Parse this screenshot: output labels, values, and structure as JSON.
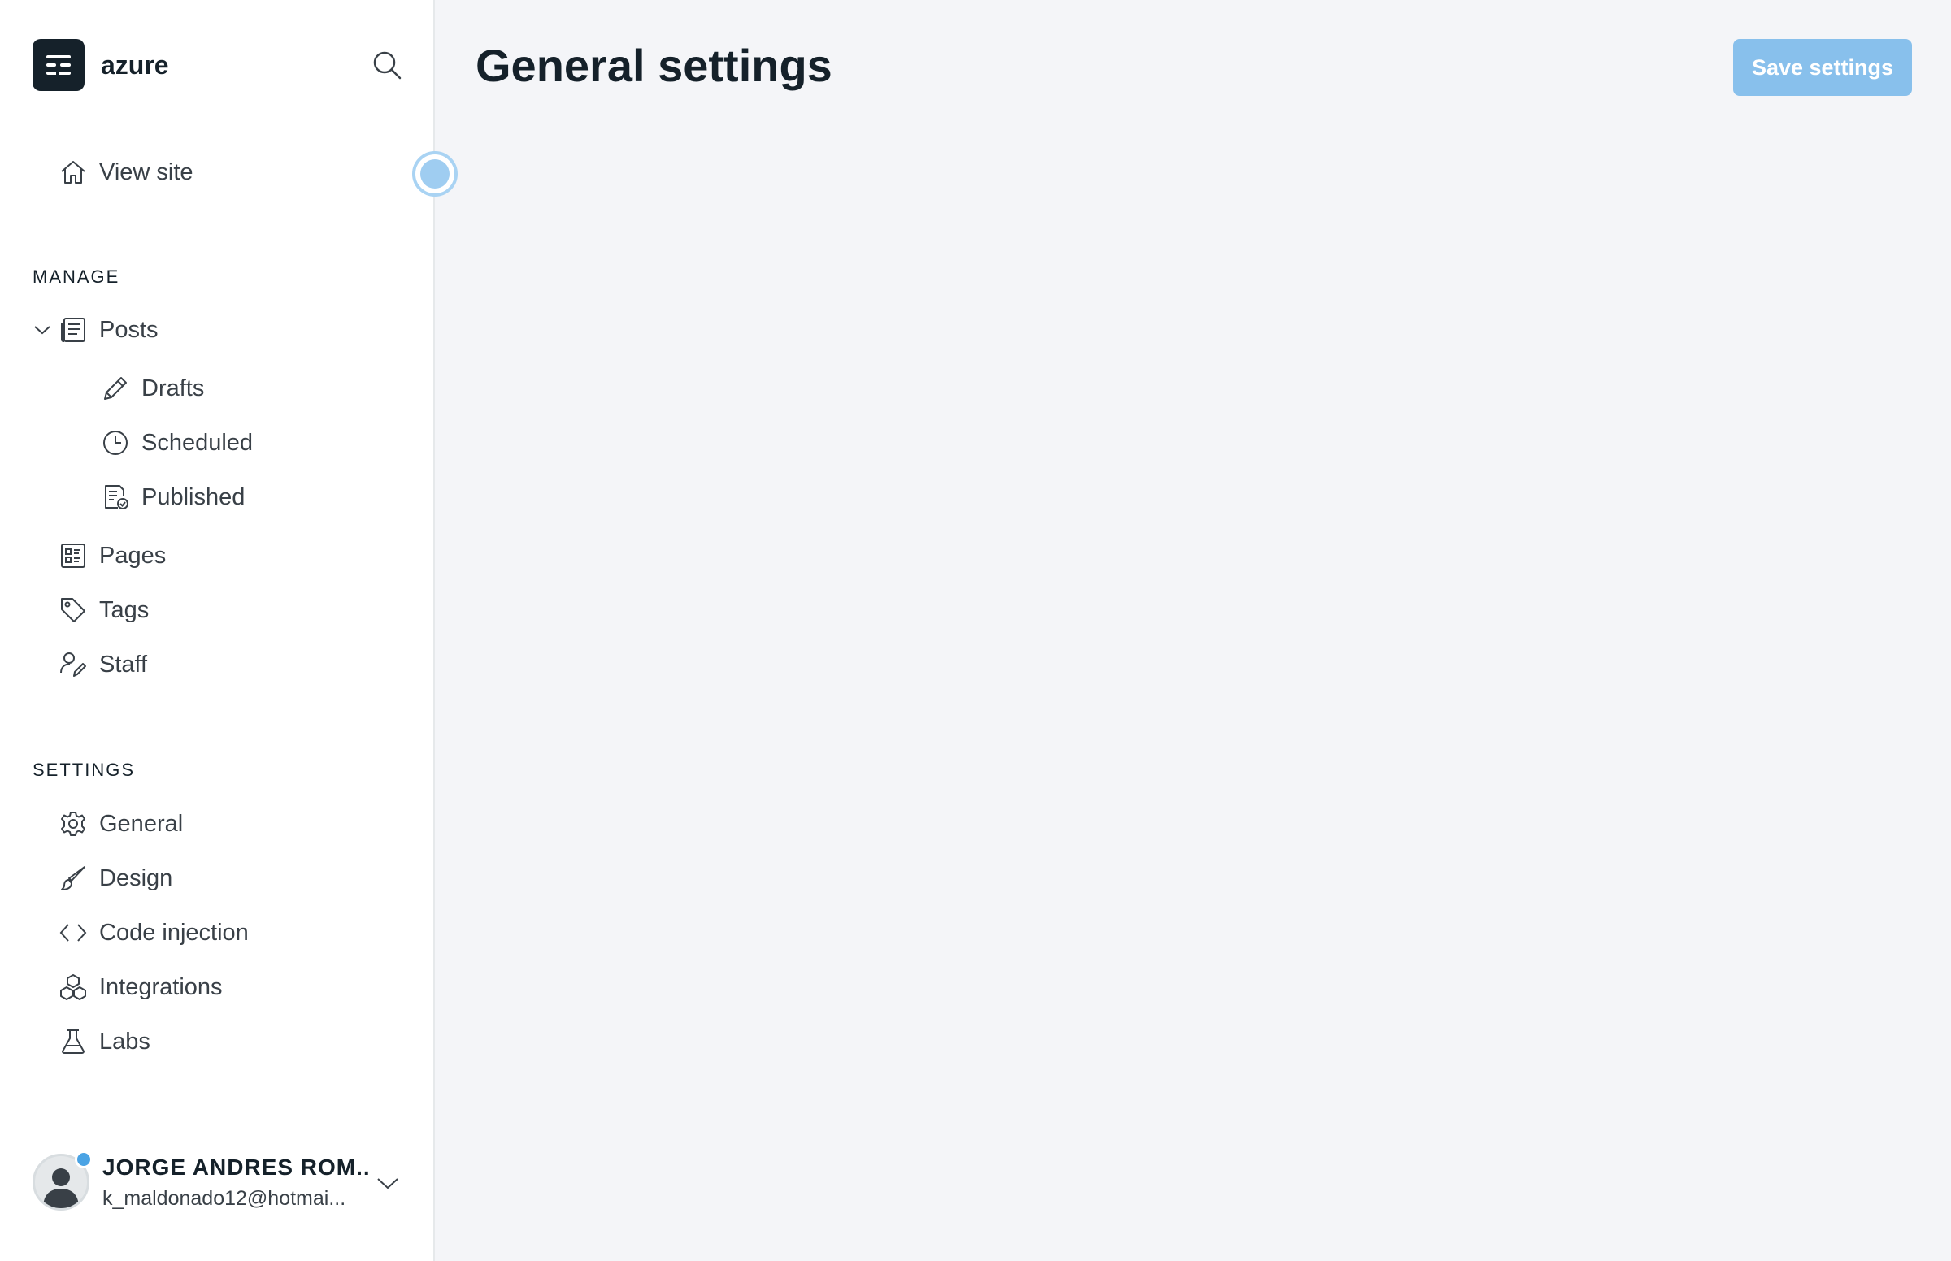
{
  "brand": {
    "name": "azure"
  },
  "nav": {
    "view_site": "View site",
    "manage_title": "MANAGE",
    "posts": "Posts",
    "drafts": "Drafts",
    "scheduled": "Scheduled",
    "published": "Published",
    "pages": "Pages",
    "tags": "Tags",
    "staff": "Staff",
    "settings_title": "SETTINGS",
    "general": "General",
    "design": "Design",
    "code_injection": "Code injection",
    "integrations": "Integrations",
    "labs": "Labs"
  },
  "user": {
    "name": "JORGE ANDRES ROM...",
    "email": "k_maldonado12@hotmai..."
  },
  "main": {
    "title": "General settings",
    "save_label": "Save settings"
  },
  "colors": {
    "accent": "#88c0ec",
    "status_dot": "#4aa3e4",
    "text": "#15212a"
  }
}
